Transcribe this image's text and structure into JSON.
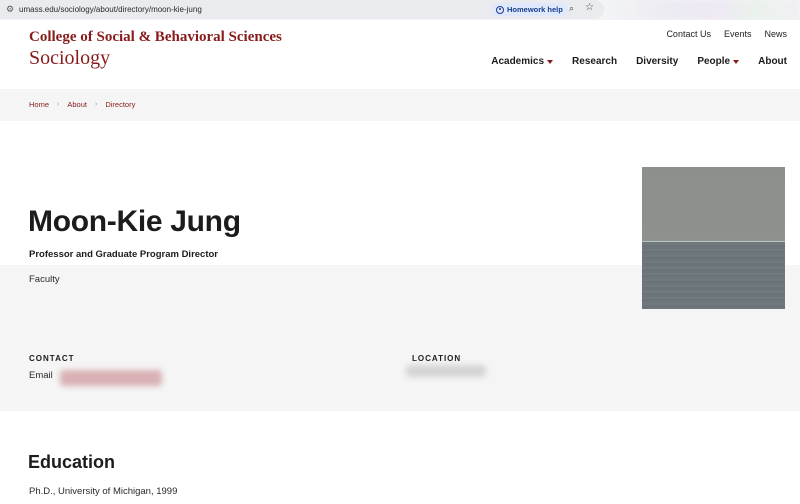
{
  "browser": {
    "url": "umass.edu/sociology/about/directory/moon-kie-jung",
    "homework_chip": "Homework help"
  },
  "header": {
    "college": "College of Social & Behavioral Sciences",
    "department": "Sociology",
    "utility_nav": [
      "Contact Us",
      "Events",
      "News"
    ],
    "main_nav": [
      {
        "label": "Academics",
        "dropdown": true
      },
      {
        "label": "Research",
        "dropdown": false
      },
      {
        "label": "Diversity",
        "dropdown": false
      },
      {
        "label": "People",
        "dropdown": true
      },
      {
        "label": "About",
        "dropdown": false
      }
    ]
  },
  "breadcrumb": [
    "Home",
    "About",
    "Directory"
  ],
  "profile": {
    "name": "Moon-Kie Jung",
    "title": "Professor and Graduate Program Director",
    "type": "Faculty",
    "contact_label": "CONTACT",
    "email_label": "Email",
    "location_label": "LOCATION"
  },
  "education": {
    "heading": "Education",
    "items": [
      "Ph.D., University of Michigan, 1999"
    ]
  },
  "colors": {
    "brand_maroon": "#881c1c",
    "band_gray": "#f4f5f4"
  }
}
